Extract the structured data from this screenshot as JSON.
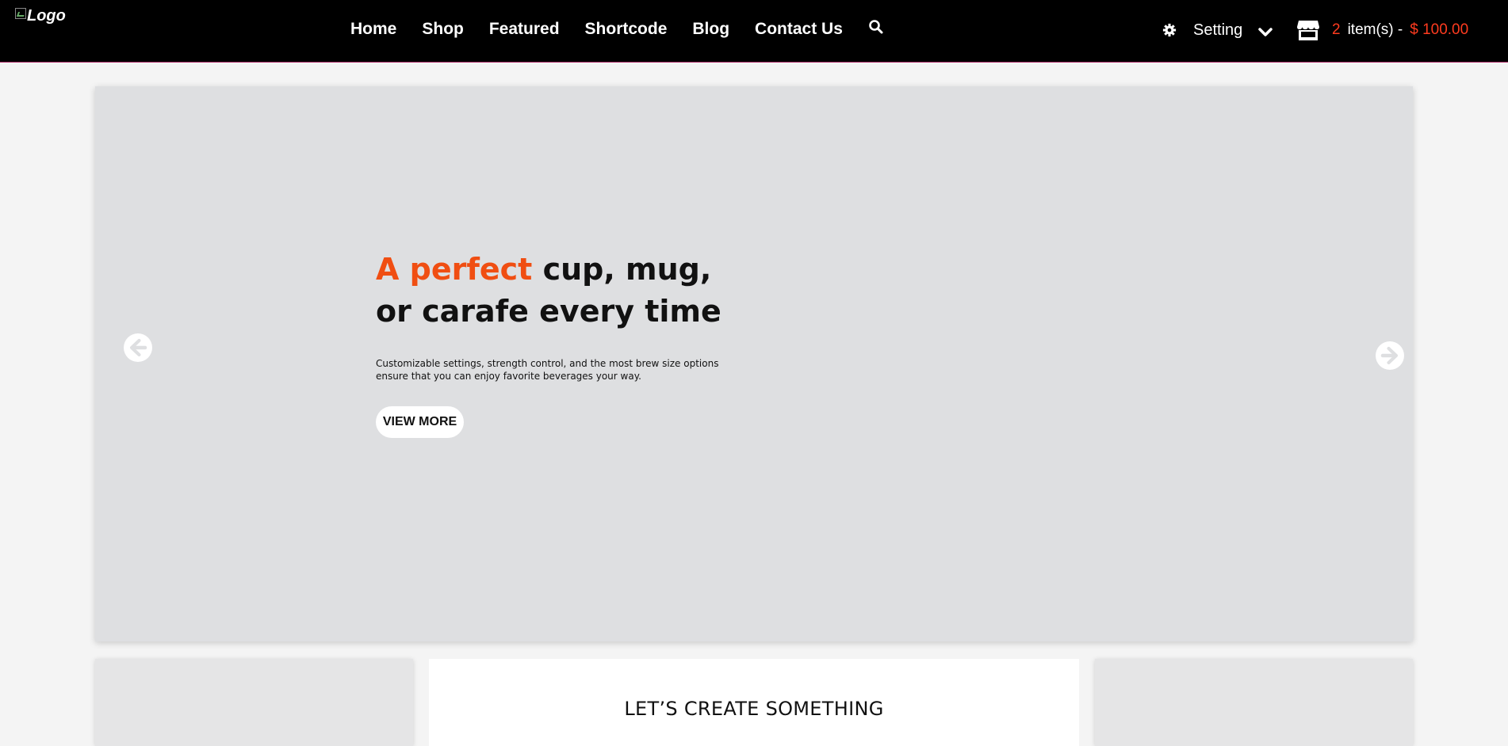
{
  "header": {
    "logo_text": "Logo",
    "nav": [
      {
        "label": "Home"
      },
      {
        "label": "Shop"
      },
      {
        "label": "Featured"
      },
      {
        "label": "Shortcode"
      },
      {
        "label": "Blog"
      },
      {
        "label": "Contact Us"
      }
    ],
    "search_icon": "search-icon",
    "setting_label": "Setting",
    "cart": {
      "count": "2",
      "items_label": "item(s) -",
      "price": "$ 100.00"
    }
  },
  "hero": {
    "title_accent": "A perfect",
    "title_rest": " cup, mug, or carafe every time",
    "description": "Customizable settings, strength control, and the most brew size options ensure that you can enjoy favorite beverages your way.",
    "button_label": "VIEW MORE"
  },
  "section": {
    "heading": "LET’S CREATE SOMETHING"
  },
  "colors": {
    "accent": "#f04e12",
    "cart_highlight": "#ff3b1f",
    "header_bg": "#000000",
    "hero_bg": "#dedfe1"
  }
}
